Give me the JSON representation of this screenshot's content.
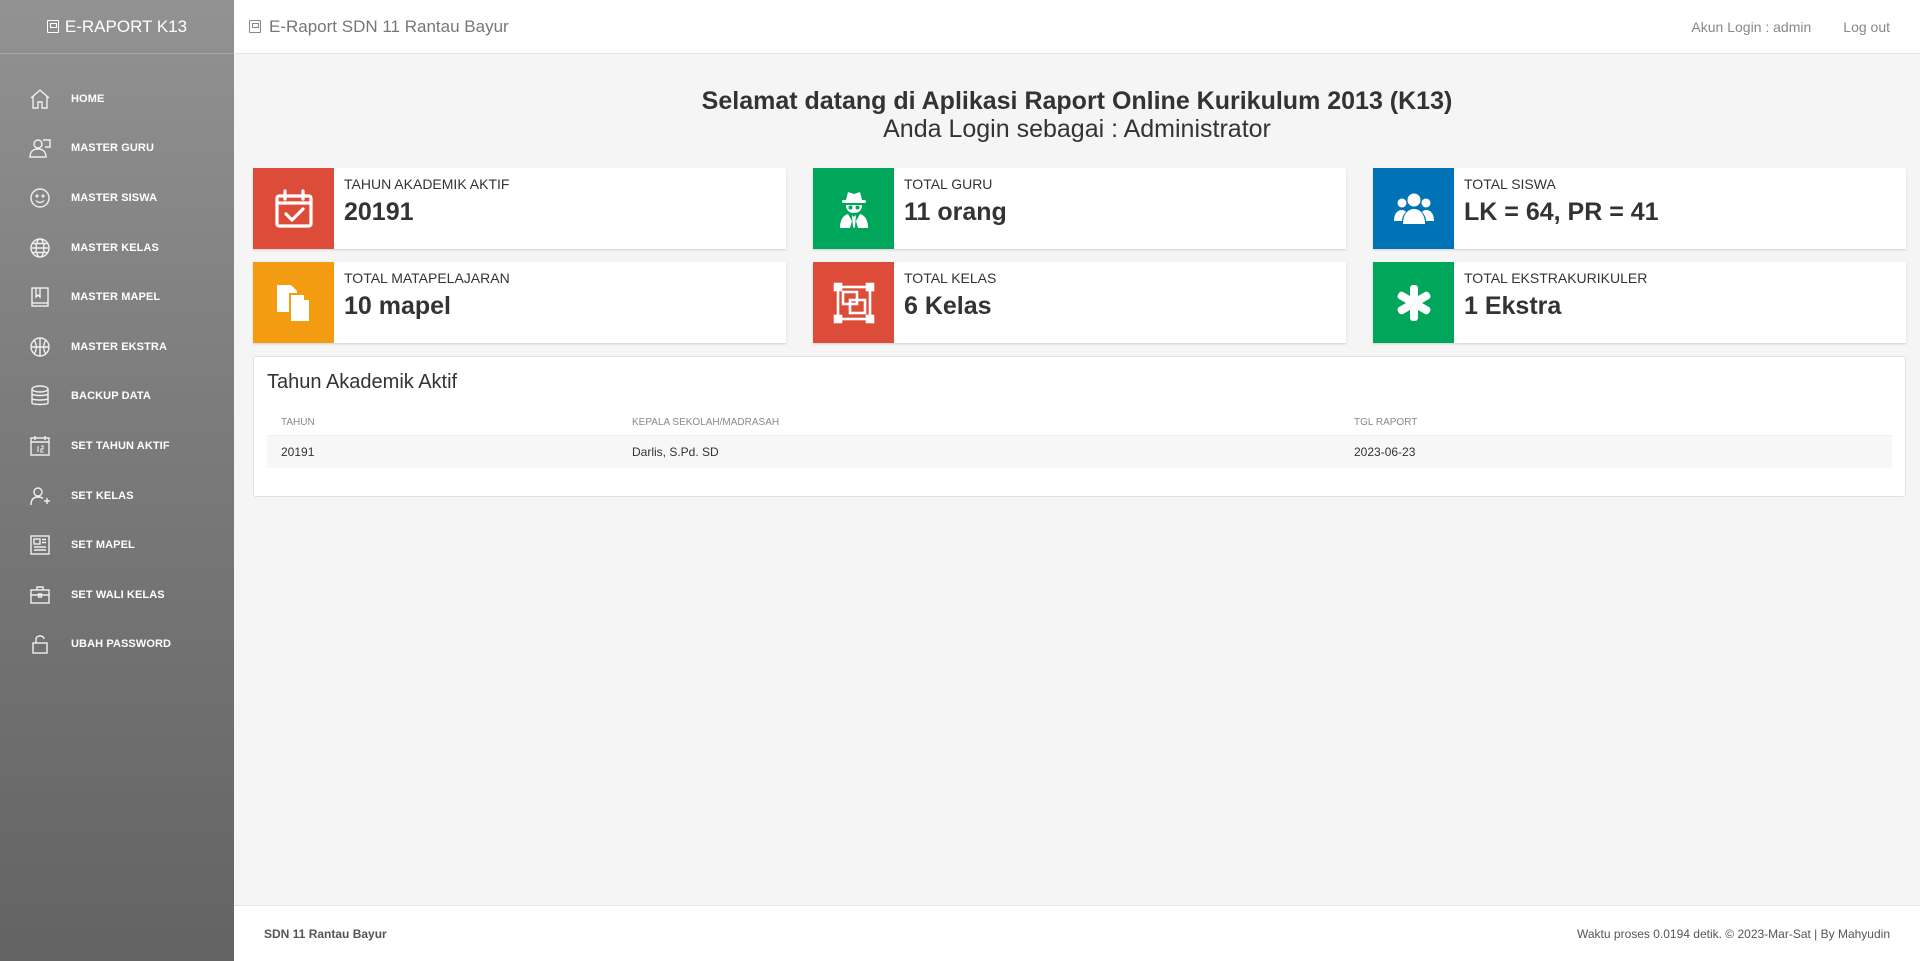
{
  "brand": {
    "title": "E-RAPORT K13"
  },
  "topbar": {
    "title": "E-Raport SDN 11 Rantau Bayur",
    "login_text": "Akun Login : admin",
    "logout_label": "Log out"
  },
  "sidebar": {
    "items": [
      {
        "label": "HOME",
        "icon": "home-icon"
      },
      {
        "label": "MASTER GURU",
        "icon": "teacher-icon"
      },
      {
        "label": "MASTER SISWA",
        "icon": "smile-icon"
      },
      {
        "label": "MASTER KELAS",
        "icon": "globe-icon"
      },
      {
        "label": "MASTER MAPEL",
        "icon": "book-icon"
      },
      {
        "label": "MASTER EKSTRA",
        "icon": "ball-icon"
      },
      {
        "label": "BACKUP DATA",
        "icon": "database-icon"
      },
      {
        "label": "SET TAHUN AKTIF",
        "icon": "calendar-icon"
      },
      {
        "label": "SET KELAS",
        "icon": "user-plus-icon"
      },
      {
        "label": "SET MAPEL",
        "icon": "newspaper-icon"
      },
      {
        "label": "SET WALI KELAS",
        "icon": "briefcase-icon"
      },
      {
        "label": "UBAH PASSWORD",
        "icon": "lock-icon"
      }
    ]
  },
  "welcome": {
    "title": "Selamat datang di Aplikasi Raport Online Kurikulum 2013 (K13)",
    "subtitle": "Anda Login sebagai : Administrator"
  },
  "stats": [
    {
      "caption": "TAHUN AKADEMIK AKTIF",
      "value": "20191",
      "color": "#dd4b39",
      "icon": "calendar-check-icon"
    },
    {
      "caption": "TOTAL GURU",
      "value": "11 orang",
      "color": "#00a65a",
      "icon": "user-secret-icon"
    },
    {
      "caption": "TOTAL SISWA",
      "value": "LK = 64, PR = 41",
      "color": "#0073b7",
      "icon": "users-icon"
    },
    {
      "caption": "TOTAL MATAPELAJARAN",
      "value": "10 mapel",
      "color": "#f39c12",
      "icon": "copy-icon"
    },
    {
      "caption": "TOTAL KELAS",
      "value": "6 Kelas",
      "color": "#dd4b39",
      "icon": "object-group-icon"
    },
    {
      "caption": "TOTAL EKSTRAKURIKULER",
      "value": "1 Ekstra",
      "color": "#00a65a",
      "icon": "asterisk-icon"
    }
  ],
  "panel": {
    "title": "Tahun Akademik Aktif",
    "columns": [
      "TAHUN",
      "KEPALA SEKOLAH/MADRASAH",
      "TGL RAPORT"
    ],
    "rows": [
      [
        "20191",
        "Darlis, S.Pd. SD",
        "2023-06-23"
      ]
    ]
  },
  "footer": {
    "left": "SDN 11 Rantau Bayur",
    "right": "Waktu proses 0.0194 detik. © 2023-Mar-Sat | By Mahyudin"
  }
}
